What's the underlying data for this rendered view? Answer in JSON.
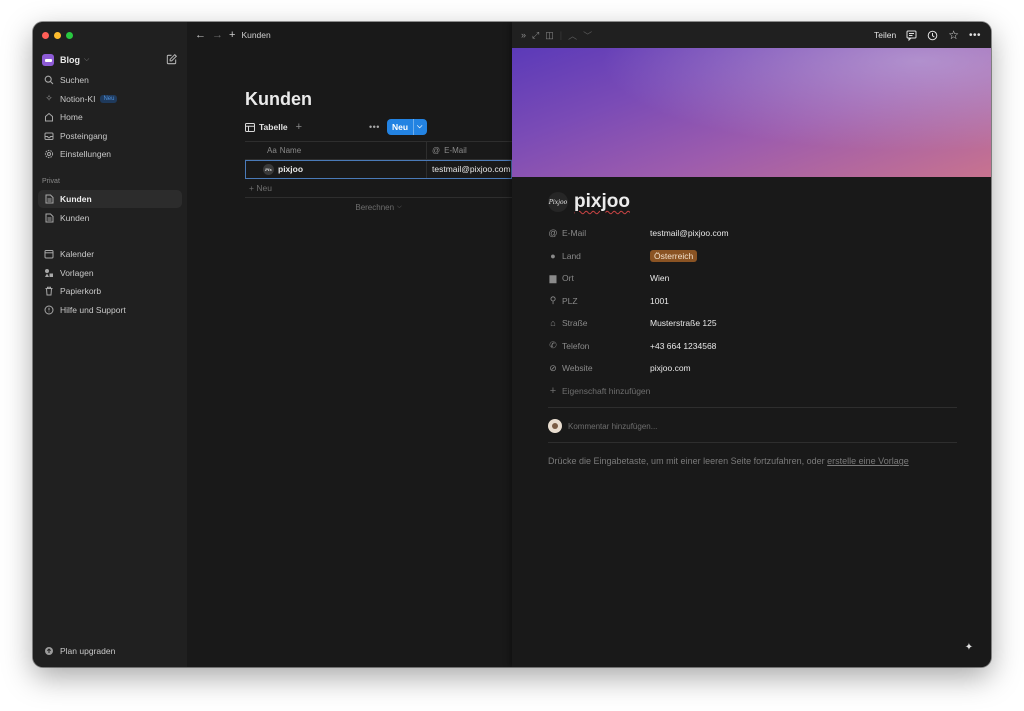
{
  "sidebar": {
    "workspace": "Blog",
    "nav": [
      {
        "label": "Suchen",
        "icon": "search-icon"
      },
      {
        "label": "Notion-KI",
        "icon": "sparkle-icon",
        "badge": "Neu"
      },
      {
        "label": "Home",
        "icon": "home-icon"
      },
      {
        "label": "Posteingang",
        "icon": "inbox-icon"
      },
      {
        "label": "Einstellungen",
        "icon": "gear-icon"
      }
    ],
    "private_label": "Privat",
    "private_pages": [
      {
        "label": "Kunden",
        "active": true
      },
      {
        "label": "Kunden",
        "active": false
      }
    ],
    "tools": [
      {
        "label": "Kalender",
        "icon": "calendar-icon"
      },
      {
        "label": "Vorlagen",
        "icon": "templates-icon"
      },
      {
        "label": "Papierkorb",
        "icon": "trash-icon"
      },
      {
        "label": "Hilfe und Support",
        "icon": "help-icon"
      }
    ],
    "upgrade": "Plan upgraden"
  },
  "main": {
    "breadcrumb": "Kunden",
    "title": "Kunden",
    "view_tab": "Tabelle",
    "new_button": "Neu",
    "columns": {
      "name": "Name",
      "name_prefix": "Aa",
      "email": "E-Mail",
      "email_prefix": "@"
    },
    "rows": [
      {
        "name": "pixjoo",
        "email": "testmail@pixjoo.com"
      }
    ],
    "new_row": "+ Neu",
    "calculate": "Berechnen"
  },
  "peek": {
    "share": "Teilen",
    "title": "pixjoo",
    "logo_text": "Pixjoo",
    "properties": [
      {
        "key": "E-Mail",
        "icon": "at-icon",
        "value": "testmail@pixjoo.com"
      },
      {
        "key": "Land",
        "icon": "globe-icon",
        "value": "Österreich",
        "tag": true
      },
      {
        "key": "Ort",
        "icon": "buildings-icon",
        "value": "Wien"
      },
      {
        "key": "PLZ",
        "icon": "pin-icon",
        "value": "1001"
      },
      {
        "key": "Straße",
        "icon": "house-icon",
        "value": "Musterstraße 125"
      },
      {
        "key": "Telefon",
        "icon": "phone-icon",
        "value": "+43 664 1234568"
      },
      {
        "key": "Website",
        "icon": "link-icon",
        "value": "pixjoo.com"
      }
    ],
    "add_property": "Eigenschaft hinzufügen",
    "comment_placeholder": "Kommentar hinzufügen...",
    "hint_text": "Drücke die Eingabetaste, um mit einer leeren Seite fortzufahren, oder ",
    "hint_link": "erstelle eine Vorlage"
  },
  "colors": {
    "accent": "#2383e2",
    "tag": "#8a5323",
    "window_bg": "#191919",
    "sidebar_bg": "#202020"
  }
}
